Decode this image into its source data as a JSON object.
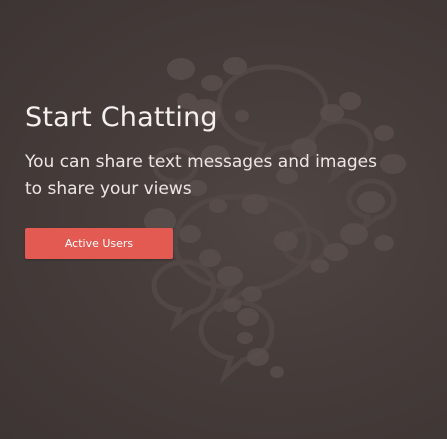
{
  "hero": {
    "title": "Start Chatting",
    "subtitle": "You can share text messages and images to share your views",
    "button_label": "Active Users"
  },
  "colors": {
    "background": "#463d3b",
    "bubble_fill": "#5a4f4c",
    "bubble_stroke": "#544946",
    "accent": "#e25a52",
    "text": "#f4f0ef"
  }
}
